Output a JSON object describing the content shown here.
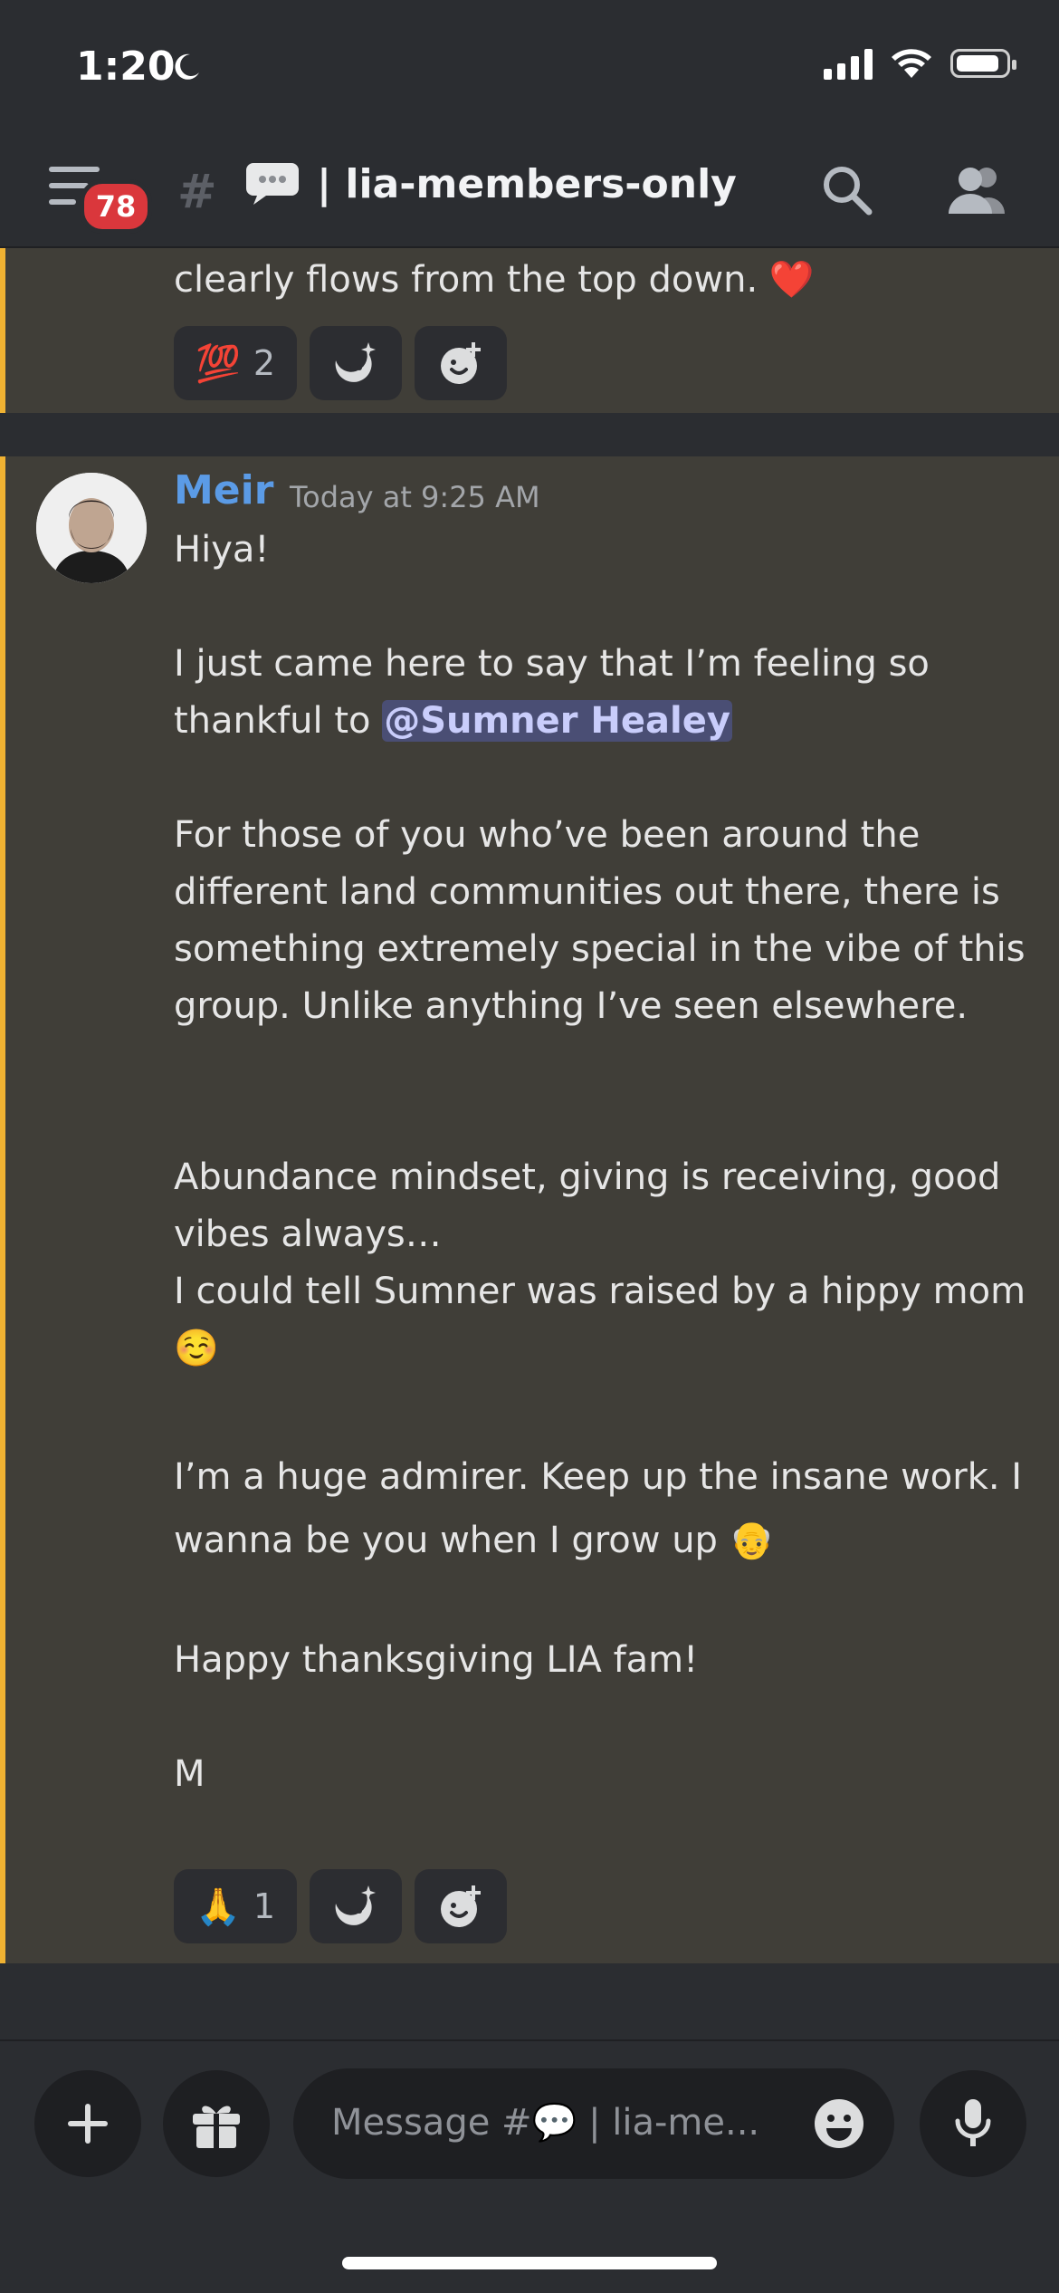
{
  "status_bar": {
    "time": "1:20"
  },
  "header": {
    "notification_count": "78",
    "channel_name": "| lia-members-only"
  },
  "previous_message": {
    "text": "clearly flows from the top down. ❤️",
    "reactions": [
      {
        "emoji": "💯",
        "count": "2"
      }
    ]
  },
  "message": {
    "author": "Meir",
    "timestamp": "Today at 9:25 AM",
    "greeting": "Hiya!",
    "line_thanks": "I just came here to say that I’m feeling so thankful to ",
    "mention": "@Sumner Healey",
    "para_community": "For those of you who’ve been around the different land communities out there, there is something extremely special in the vibe of this group. Unlike anything I’ve seen elsewhere.",
    "para_abundance": "Abundance mindset, giving is receiving, good vibes always…",
    "para_hippy": "I could tell Sumner was raised by a hippy mom ☺️",
    "para_admirer": "I’m a huge admirer. Keep up the insane work. I wanna be you when I grow up 👴",
    "para_thanksgiving": "Happy thanksgiving LIA fam!",
    "signoff": "M",
    "reactions": [
      {
        "emoji": "🙏",
        "count": "1"
      }
    ]
  },
  "composer": {
    "placeholder": "Message #💬 | lia-me..."
  },
  "colors": {
    "background": "#2b2d31",
    "highlight_bg": "#403e38",
    "highlight_bar": "#f0b232",
    "author": "#5b9be6",
    "badge": "#da373c",
    "mention_bg": "#4a4e74"
  },
  "icons": [
    "moon-icon",
    "signal-icon",
    "wifi-icon",
    "battery-icon",
    "hamburger-icon",
    "thread-icon",
    "speech-bubble-icon",
    "search-icon",
    "members-icon",
    "add-reaction-icon",
    "super-reaction-icon",
    "plus-icon",
    "gift-icon",
    "emoji-icon",
    "mic-icon"
  ]
}
